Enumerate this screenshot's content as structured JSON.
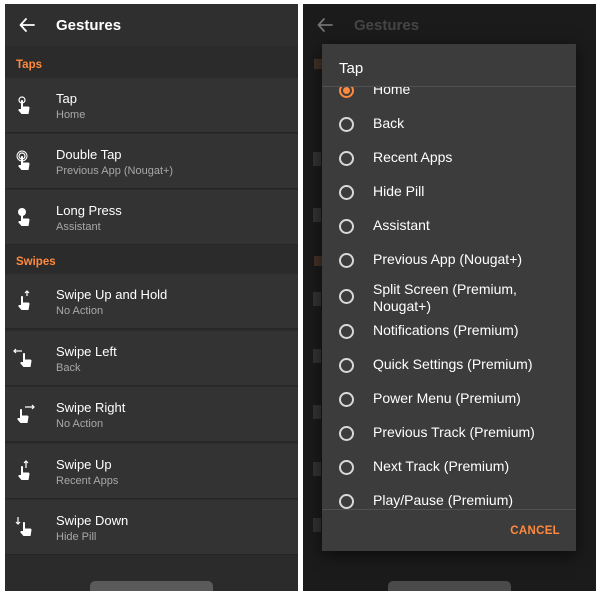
{
  "screen_title": "Gestures",
  "sections": {
    "taps": "Taps",
    "swipes": "Swipes"
  },
  "gestures": [
    {
      "title": "Tap",
      "action": "Home",
      "icon": "single-tap-icon"
    },
    {
      "title": "Double Tap",
      "action": "Previous App (Nougat+)",
      "icon": "double-tap-icon"
    },
    {
      "title": "Long Press",
      "action": "Assistant",
      "icon": "long-press-icon"
    },
    {
      "title": "Swipe Up and Hold",
      "action": "No Action",
      "icon": "swipe-up-hold-icon"
    },
    {
      "title": "Swipe Left",
      "action": "Back",
      "icon": "swipe-left-icon"
    },
    {
      "title": "Swipe Right",
      "action": "No Action",
      "icon": "swipe-right-icon"
    },
    {
      "title": "Swipe Up",
      "action": "Recent Apps",
      "icon": "swipe-up-icon"
    },
    {
      "title": "Swipe Down",
      "action": "Hide Pill",
      "icon": "swipe-down-icon"
    }
  ],
  "dialog": {
    "title": "Tap",
    "selected": "Home",
    "options": [
      "Home",
      "Back",
      "Recent Apps",
      "Hide Pill",
      "Assistant",
      "Previous App (Nougat+)",
      "Split Screen (Premium, Nougat+)",
      "Notifications (Premium)",
      "Quick Settings (Premium)",
      "Power Menu (Premium)",
      "Previous Track (Premium)",
      "Next Track (Premium)",
      "Play/Pause (Premium)"
    ],
    "cancel_label": "CANCEL"
  },
  "colors": {
    "accent": "#ff8a3d",
    "background": "#2b2b2b",
    "row": "#333333",
    "dialog": "#3c3c3c"
  }
}
